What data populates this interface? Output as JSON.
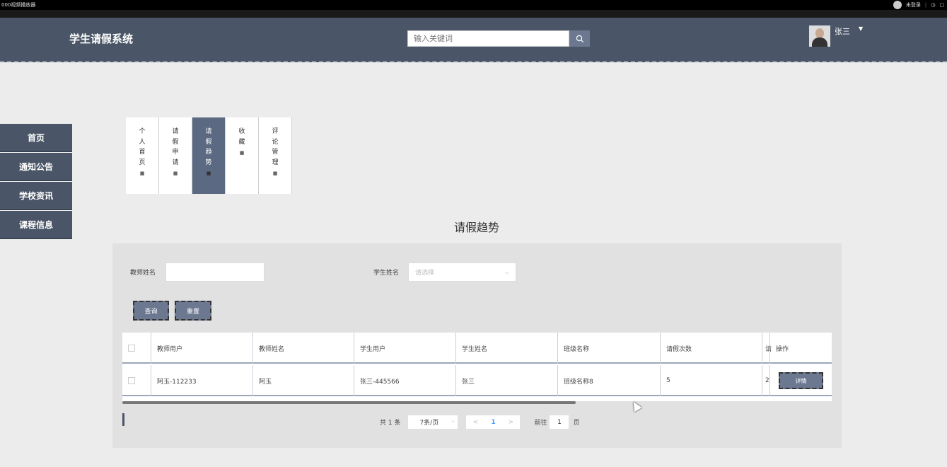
{
  "browser": {
    "tab_text": "000视频播放器",
    "login_text": "未登录",
    "sep": "|"
  },
  "header": {
    "brand": "学生请假系统",
    "search_placeholder": "输入关键词",
    "user_name": "张三"
  },
  "sidebar": {
    "items": [
      {
        "label": "首页"
      },
      {
        "label": "通知公告"
      },
      {
        "label": "学校资讯"
      },
      {
        "label": "课程信息"
      }
    ]
  },
  "vtabs": [
    {
      "chars": [
        "个",
        "人",
        "首",
        "页"
      ],
      "active": false
    },
    {
      "chars": [
        "请",
        "假",
        "申",
        "请"
      ],
      "active": false
    },
    {
      "chars": [
        "请",
        "假",
        "趋",
        "势"
      ],
      "active": true
    },
    {
      "chars": [
        "收",
        "藏"
      ],
      "active": false
    },
    {
      "chars": [
        "评",
        "论",
        "管",
        "理"
      ],
      "active": false
    }
  ],
  "page_title": "请假趋势",
  "filters": {
    "teacher_label": "教师姓名",
    "student_label": "学生姓名",
    "student_placeholder": "请选择",
    "query_label": "查询",
    "reset_label": "重置"
  },
  "table": {
    "headers": [
      "教师用户",
      "教师姓名",
      "学生用户",
      "学生姓名",
      "班级名称",
      "请假次数",
      "请",
      "操作"
    ],
    "rows": [
      {
        "teacher_user": "阿玉-112233",
        "teacher_name": "阿玉",
        "student_user": "张三-445566",
        "student_name": "张三",
        "class_name": "班级名称8",
        "leave_count": "5",
        "partial": "2",
        "action": "详情"
      }
    ]
  },
  "pager": {
    "total": "共 1 条",
    "page_size": "7条/页",
    "prev": "<",
    "current": "1",
    "next": ">",
    "goto_label": "前往",
    "goto_value": "1",
    "page_unit": "页"
  }
}
